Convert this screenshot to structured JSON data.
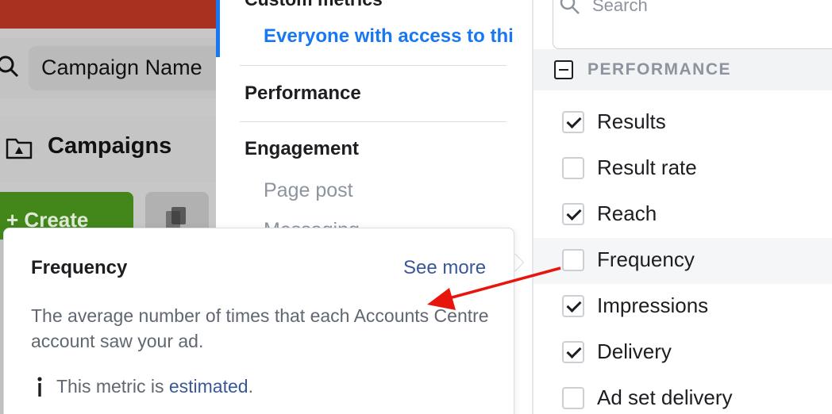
{
  "background": {
    "search_value": "Campaign Name",
    "campaigns_title": "Campaigns",
    "create_label": "Create"
  },
  "categories": {
    "clipped_title": "Custom metrics",
    "active_item": "Everyone with access to thi",
    "performance": "Performance",
    "engagement": "Engagement",
    "page_post": "Page post",
    "messaging": "Messaging"
  },
  "metrics": {
    "search_placeholder": "Search",
    "section_label": "PERFORMANCE",
    "items": [
      {
        "label": "Results",
        "checked": true
      },
      {
        "label": "Result rate",
        "checked": false
      },
      {
        "label": "Reach",
        "checked": true
      },
      {
        "label": "Frequency",
        "checked": false
      },
      {
        "label": "Impressions",
        "checked": true
      },
      {
        "label": "Delivery",
        "checked": true
      },
      {
        "label": "Ad set delivery",
        "checked": false
      }
    ]
  },
  "tooltip": {
    "title": "Frequency",
    "see_more": "See more",
    "description": "The average number of times that each Accounts Centre account saw your ad.",
    "note_prefix": "This metric is ",
    "note_link": "estimated",
    "note_suffix": "."
  },
  "colors": {
    "accent_blue": "#1877f2",
    "link_blue": "#385898",
    "annotation_red": "#e8150d"
  }
}
